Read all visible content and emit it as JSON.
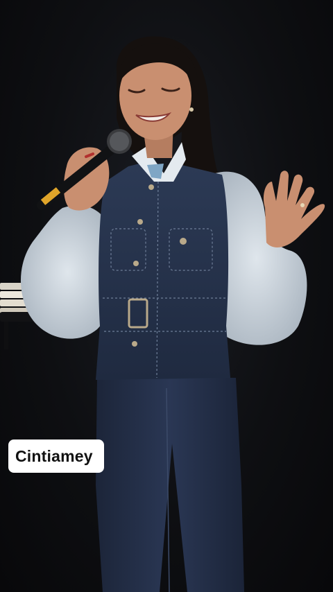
{
  "name_tag": {
    "label": "Cintiamey"
  },
  "colors": {
    "background": "#0b0b0d",
    "denim": "#27344d",
    "shirt": "#c9d3dc",
    "hair": "#15100e",
    "skin": "#c98f70",
    "name_tag_bg": "#ffffff",
    "name_tag_text": "#111111"
  }
}
